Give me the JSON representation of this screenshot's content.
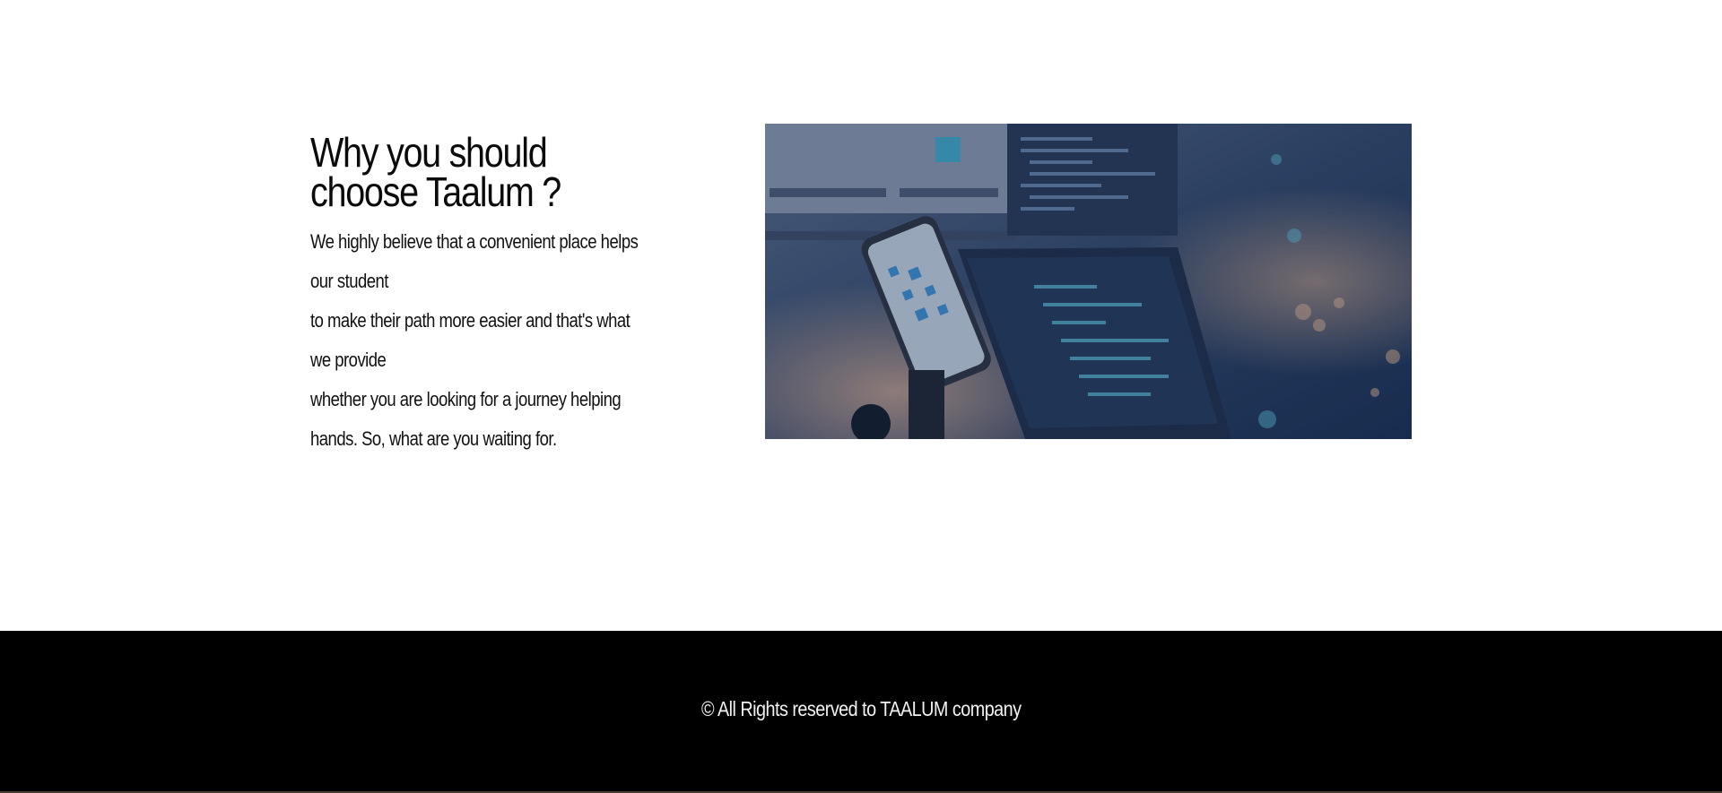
{
  "why_section": {
    "heading_line1": "Why you should",
    "heading_line2": "choose Taalum ?",
    "paragraph_lines": [
      "We highly believe that a convenient place helps",
      "our student",
      "to make their path more easier and that's what",
      "we provide",
      "whether you are looking for a journey helping",
      "hands. So, what are you waiting for."
    ]
  },
  "hero_image": {
    "subject": "phone-and-code-monitors-image"
  },
  "footer": {
    "copyright": "© All Rights reserved to TAALUM company"
  },
  "colors": {
    "footer_bg": "#000000",
    "image_overlay": "#1f3559"
  }
}
